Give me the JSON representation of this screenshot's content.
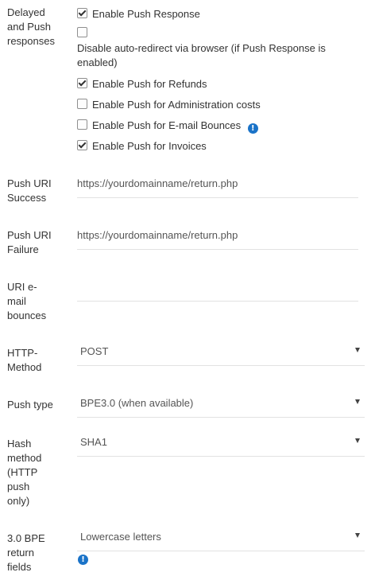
{
  "push_responses": {
    "label": "Delayed\nand Push\nresponses",
    "options": [
      {
        "label": "Enable Push Response",
        "checked": true
      },
      {
        "label": "Disable auto-redirect via browser (if Push Response is enabled)",
        "checked": false
      },
      {
        "label": "Enable Push for Refunds",
        "checked": true
      },
      {
        "label": "Enable Push for Administration costs",
        "checked": false
      },
      {
        "label": "Enable Push for E-mail Bounces",
        "checked": false
      },
      {
        "label": "Enable Push for Invoices",
        "checked": true
      }
    ],
    "info_icon": "info-icon"
  },
  "push_uri_success": {
    "label": "Push URI\nSuccess",
    "value": "https://yourdomainname/return.php"
  },
  "push_uri_failure": {
    "label": "Push URI\nFailure",
    "value": "https://yourdomainname/return.php"
  },
  "uri_email_bounces": {
    "label": "URI e-\nmail\nbounces",
    "value": ""
  },
  "http_method": {
    "label": "HTTP-\nMethod",
    "selected": "POST"
  },
  "push_type": {
    "label": "Push type",
    "selected": "BPE3.0 (when available)"
  },
  "hash_method": {
    "label": "Hash\nmethod\n(HTTP\npush\nonly)",
    "selected": "SHA1"
  },
  "bpe_return_fields": {
    "label": "3.0 BPE\nreturn\nfields",
    "selected": "Lowercase letters",
    "info_icon": "info-icon"
  },
  "colors": {
    "info_icon": "#1a73c8",
    "underline": "#e2e2e2",
    "text": "#333333"
  }
}
